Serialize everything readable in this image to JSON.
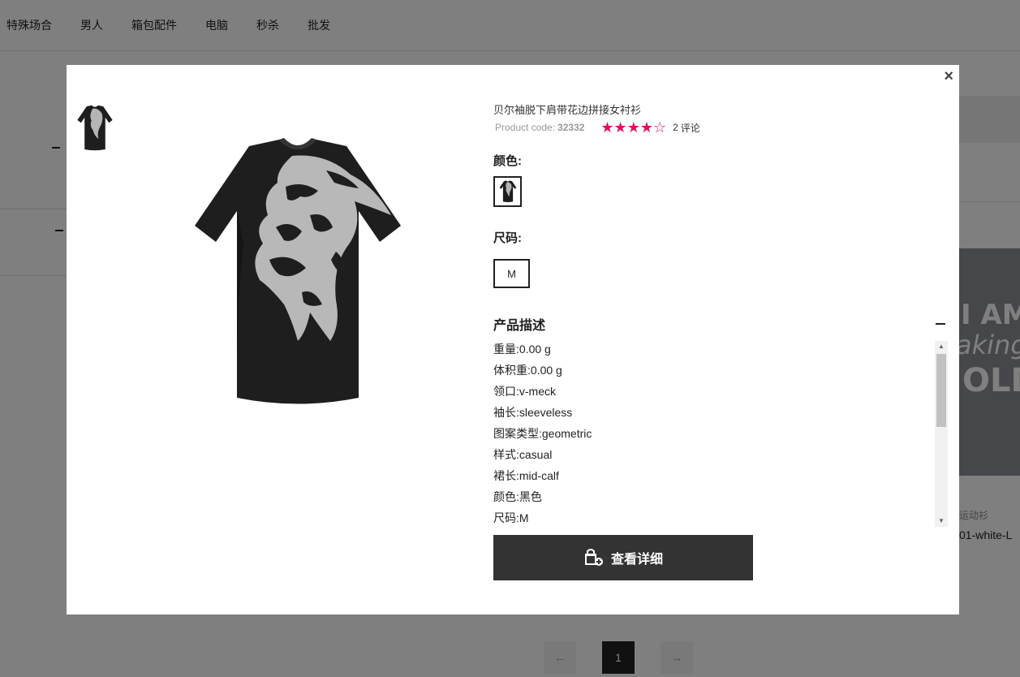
{
  "nav": {
    "items": [
      "特殊场合",
      "男人",
      "箱包配件",
      "电脑",
      "秒杀",
      "批发"
    ]
  },
  "background": {
    "product_image_text": [
      "I AM",
      "aking",
      "OLD"
    ],
    "product_category": "运动衫",
    "product_name": "01-white-L",
    "pagination": {
      "prev": "←",
      "current": "1",
      "next": "→"
    }
  },
  "modal": {
    "close": "×",
    "title": "贝尔袖脱下肩带花边拼接女衬衫",
    "product_code_label": "Product code:",
    "product_code": "32332",
    "rating": {
      "value": 4,
      "max": 5,
      "stars": "★★★★☆",
      "color": "#e0115f"
    },
    "review_count": "2",
    "review_label": "评论",
    "color_label": "颜色:",
    "size_label": "尺码:",
    "size_option": "M",
    "description_title": "产品描述",
    "description": [
      {
        "k": "重量:",
        "v": "0.00 g"
      },
      {
        "k": "体积重:",
        "v": "0.00 g"
      },
      {
        "k": "领口:",
        "v": "v-meck"
      },
      {
        "k": "袖长:",
        "v": "sleeveless"
      },
      {
        "k": "图案类型:",
        "v": "geometric"
      },
      {
        "k": "样式:",
        "v": "casual"
      },
      {
        "k": "裙长:",
        "v": "mid-calf"
      },
      {
        "k": "颜色:",
        "v": "黑色"
      },
      {
        "k": "尺码:",
        "v": "M"
      }
    ],
    "detail_button": "查看详细",
    "icons": {
      "close": "close-icon",
      "bag": "shopping-bag-icon",
      "collapse": "minus-icon"
    }
  }
}
